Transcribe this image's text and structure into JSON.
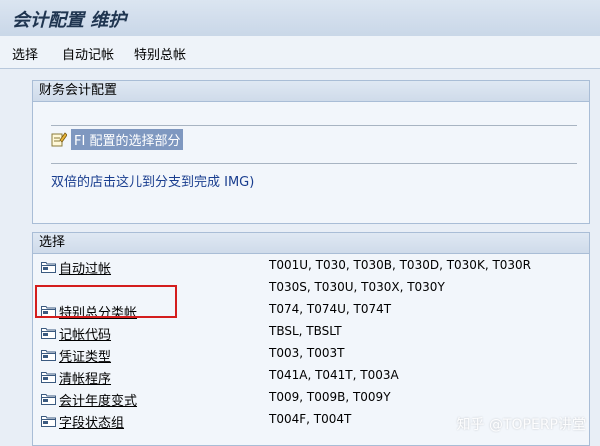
{
  "window": {
    "title": "会计配置 维护"
  },
  "menu": {
    "items": [
      "选择",
      "自动记帐",
      "特别总帐"
    ]
  },
  "config_panel": {
    "heading": "财务会计配置",
    "link_label": "FI 配置的选择部分",
    "hint": "双倍的店击这儿到分支到完成 IMG)"
  },
  "selection_panel": {
    "heading": "选择",
    "rows": [
      {
        "label": "自动过帐",
        "tables": "T001U, T030,  T030B, T030D, T030K, T030R"
      },
      {
        "label": "",
        "tables": "T030S, T030U, T030X, T030Y"
      },
      {
        "label": "特别总分类帐",
        "tables": "T074,  T074U, T074T"
      },
      {
        "label": "记帐代码",
        "tables": "TBSL,  TBSLT"
      },
      {
        "label": "凭证类型",
        "tables": "T003,  T003T"
      },
      {
        "label": "清帐程序",
        "tables": "T041A, T041T, T003A"
      },
      {
        "label": "会计年度变式",
        "tables": "T009,  T009B, T009Y"
      },
      {
        "label": "字段状态组",
        "tables": "T004F, T004T"
      }
    ]
  },
  "watermark": "知乎 @TOPERP讲堂",
  "colors": {
    "highlight_box": "#d41d1d",
    "selected_link_bg": "#7f98c0"
  }
}
